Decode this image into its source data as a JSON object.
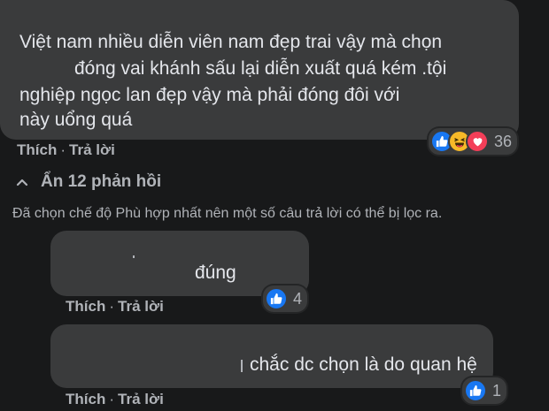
{
  "comment": {
    "lines": [
      "Việt nam nhiều diễn viên nam đẹp trai vậy mà chọn",
      "đóng vai khánh sấu lại diễn xuất quá kém .tội",
      "nghiệp ngọc lan đẹp vậy mà phải đóng đôi với",
      "này uổng quá"
    ],
    "reactions": {
      "icons": [
        "like-icon",
        "haha-icon",
        "love-icon"
      ],
      "count": "36"
    },
    "actions": {
      "like": "Thích",
      "separator": "·",
      "reply": "Trả lời"
    }
  },
  "hide_replies": {
    "label": "Ẩn 12 phản hồi"
  },
  "filter_notice": "Đã chọn chế độ Phù hợp nhất nên một số câu trả lời có thể bị lọc ra.",
  "replies": [
    {
      "text": "đúng",
      "reaction_icon": "like-icon",
      "reaction_count": "4",
      "like_label": "Thích",
      "separator": "·",
      "reply_label": "Trả lời"
    },
    {
      "text": "chắc dc chọn là do quan hệ",
      "reaction_icon": "like-icon",
      "reaction_count": "1",
      "like_label": "Thích",
      "separator": "·",
      "reply_label": "Trả lời"
    }
  ],
  "colors": {
    "background": "#18191a",
    "bubble": "#3a3b3c",
    "text": "#e4e6eb",
    "secondary_text": "#b0b3b8",
    "like_blue": "#1877f2",
    "haha_yellow": "#f7b928",
    "love_red": "#f33e58"
  }
}
